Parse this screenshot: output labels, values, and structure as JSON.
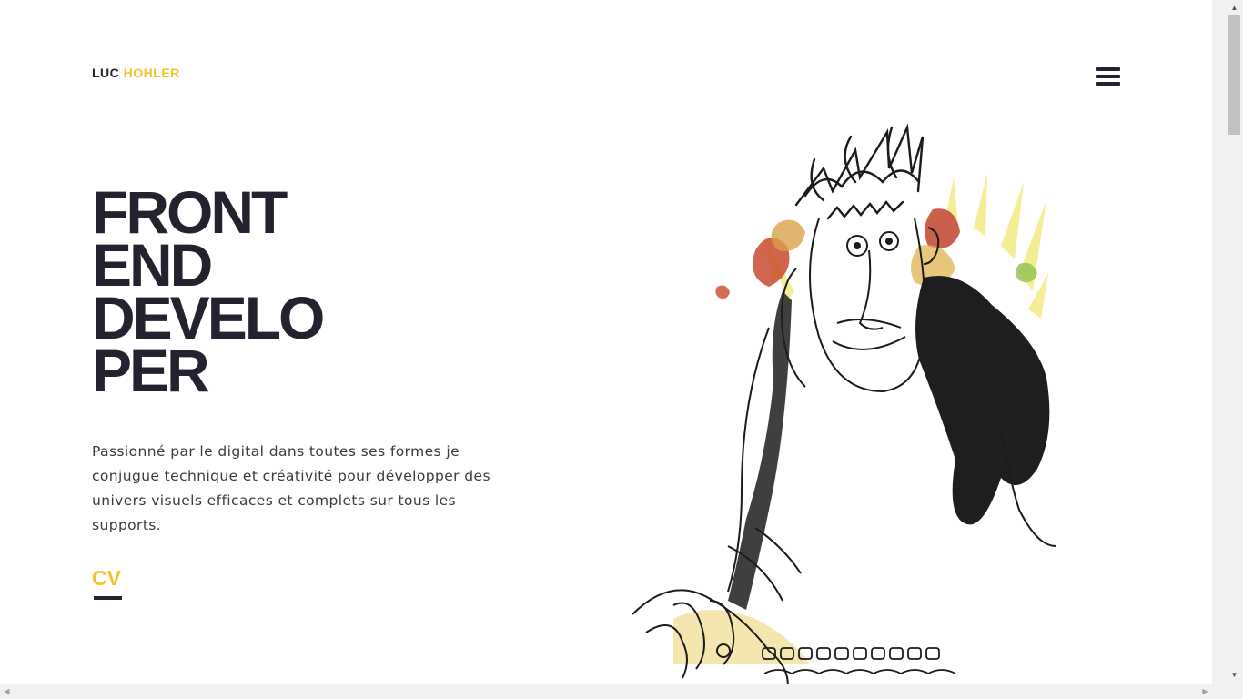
{
  "header": {
    "logo_first": "LUC",
    "logo_last": "HOHLER",
    "menu_icon": "hamburger-menu-icon"
  },
  "hero": {
    "headline_lines": [
      "FRONT",
      "END",
      "DEVELO",
      "PER"
    ],
    "intro": "Passionné par le digital dans toutes ses formes je conjugue technique et créativité pour développer des univers visuels efficaces et complets sur tous les supports.",
    "cv_label": "CV"
  },
  "illustration": {
    "subject": "ink-sketch-portrait"
  },
  "colors": {
    "accent": "#f5c22b",
    "text_dark": "#23222e",
    "background": "#ffffff"
  },
  "scrollbars": {
    "up_arrow": "▲",
    "down_arrow": "▼",
    "left_arrow": "◀",
    "right_arrow": "▶"
  }
}
